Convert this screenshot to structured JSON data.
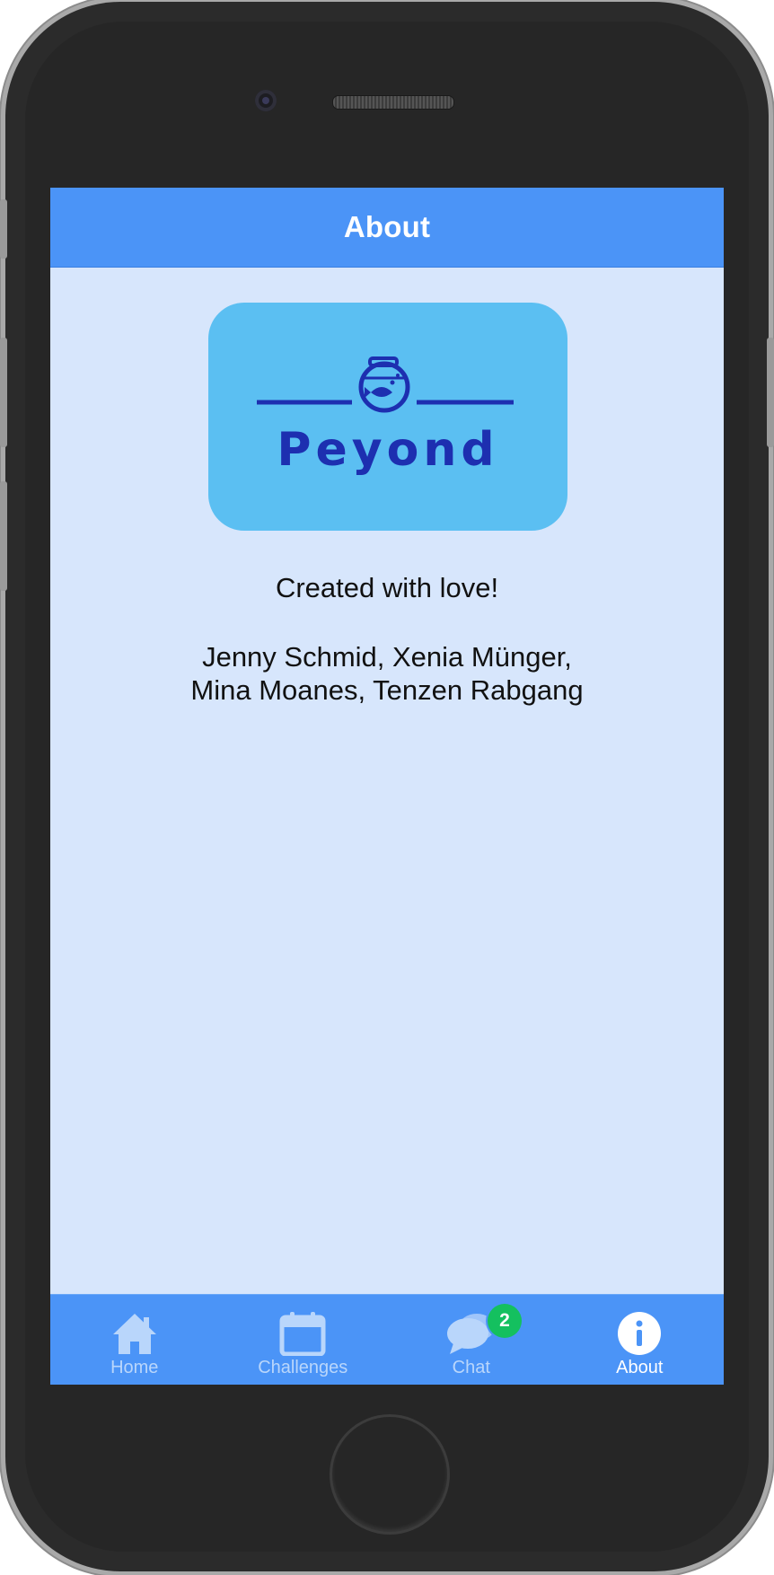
{
  "navbar": {
    "title": "About"
  },
  "logo": {
    "wordmark": "Peyond",
    "icon": "fishbowl-icon",
    "background_color": "#5bbff2",
    "ink_color": "#1d2fb0"
  },
  "credits": {
    "title": "Created with love!",
    "names_line1": "Jenny Schmid, Xenia Münger,",
    "names_line2": "Mina Moanes, Tenzen Rabgang"
  },
  "tabbar": {
    "tabs": [
      {
        "label": "Home",
        "icon": "home-icon",
        "active": false
      },
      {
        "label": "Challenges",
        "icon": "calendar-icon",
        "active": false
      },
      {
        "label": "Chat",
        "icon": "chat-bubbles-icon",
        "active": false,
        "badge": "2"
      },
      {
        "label": "About",
        "icon": "info-icon",
        "active": true
      }
    ]
  },
  "colors": {
    "accent": "#4b94f7",
    "screen_background": "#d7e6fc",
    "badge": "#14c05f",
    "inactive_tab": "#b9d6fb"
  }
}
